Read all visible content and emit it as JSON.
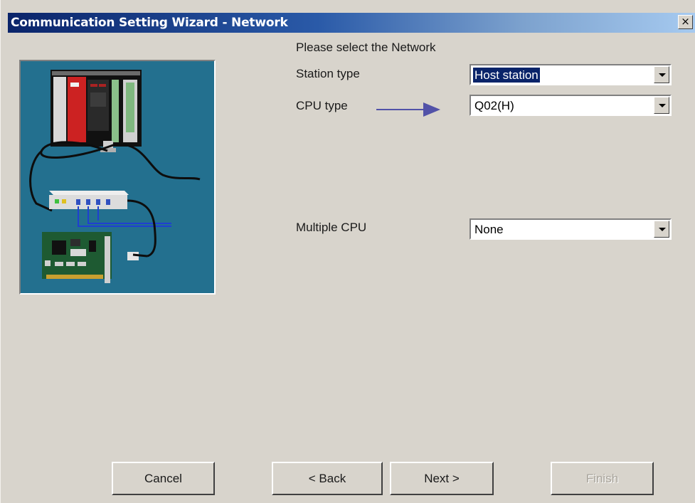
{
  "window": {
    "title": "Communication Setting Wizard - Network",
    "close_label": "×"
  },
  "prompt": "Please select the Network",
  "fields": {
    "station_type": {
      "label": "Station type",
      "value": "Host station"
    },
    "cpu_type": {
      "label": "CPU type",
      "value": "Q02(H)"
    },
    "multiple_cpu": {
      "label": "Multiple CPU",
      "value": "None"
    }
  },
  "buttons": {
    "cancel": "Cancel",
    "back": "< Back",
    "next": "Next >",
    "finish": "Finish"
  },
  "colors": {
    "title_start": "#0a246a",
    "title_end": "#a6caf0",
    "illustration_bg": "#23708f",
    "annotation_arrow": "#5252a8",
    "selection": "#0a246a"
  },
  "icons": {
    "illustration": "plc-network-illustration",
    "annotation": "arrow-right-icon",
    "dropdown": "chevron-down-icon",
    "close": "close-icon"
  },
  "state": {
    "finish_enabled": false
  }
}
